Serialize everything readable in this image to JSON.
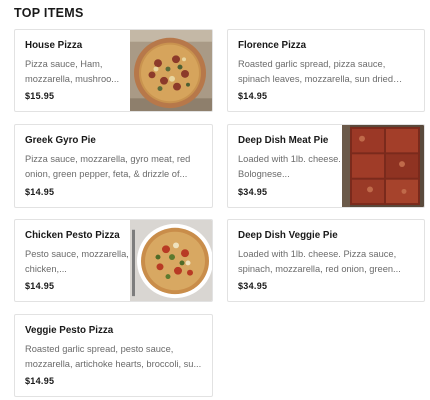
{
  "section": {
    "title": "TOP ITEMS"
  },
  "items": [
    {
      "name": "House Pizza",
      "description": "Pizza sauce, Ham, mozzarella, mushroo...",
      "price": "$15.95",
      "image": "house-pizza-photo"
    },
    {
      "name": "Florence Pizza",
      "description": "Roasted garlic spread, pizza sauce, spinach leaves, mozzarella, sun dried tomato,...",
      "price": "$14.95"
    },
    {
      "name": "Greek Gyro Pie",
      "description": "Pizza sauce, mozzarella, gyro meat, red onion, green pepper, feta, & drizzle of...",
      "price": "$14.95"
    },
    {
      "name": "Deep Dish Meat Pie",
      "description": "Loaded with 1lb. cheese. Bolognese...",
      "price": "$34.95",
      "image": "deep-dish-meat-pie-photo"
    },
    {
      "name": "Chicken Pesto Pizza",
      "description": "Pesto sauce, mozzarella, chicken,...",
      "price": "$14.95",
      "image": "chicken-pesto-pizza-photo"
    },
    {
      "name": "Deep Dish Veggie Pie",
      "description": "Loaded with 1lb. cheese. Pizza sauce, spinach, mozzarella, red onion, green...",
      "price": "$34.95"
    },
    {
      "name": "Veggie Pesto Pizza",
      "description": "Roasted garlic spread, pesto sauce, mozzarella, artichoke hearts, broccoli, su...",
      "price": "$14.95"
    }
  ]
}
